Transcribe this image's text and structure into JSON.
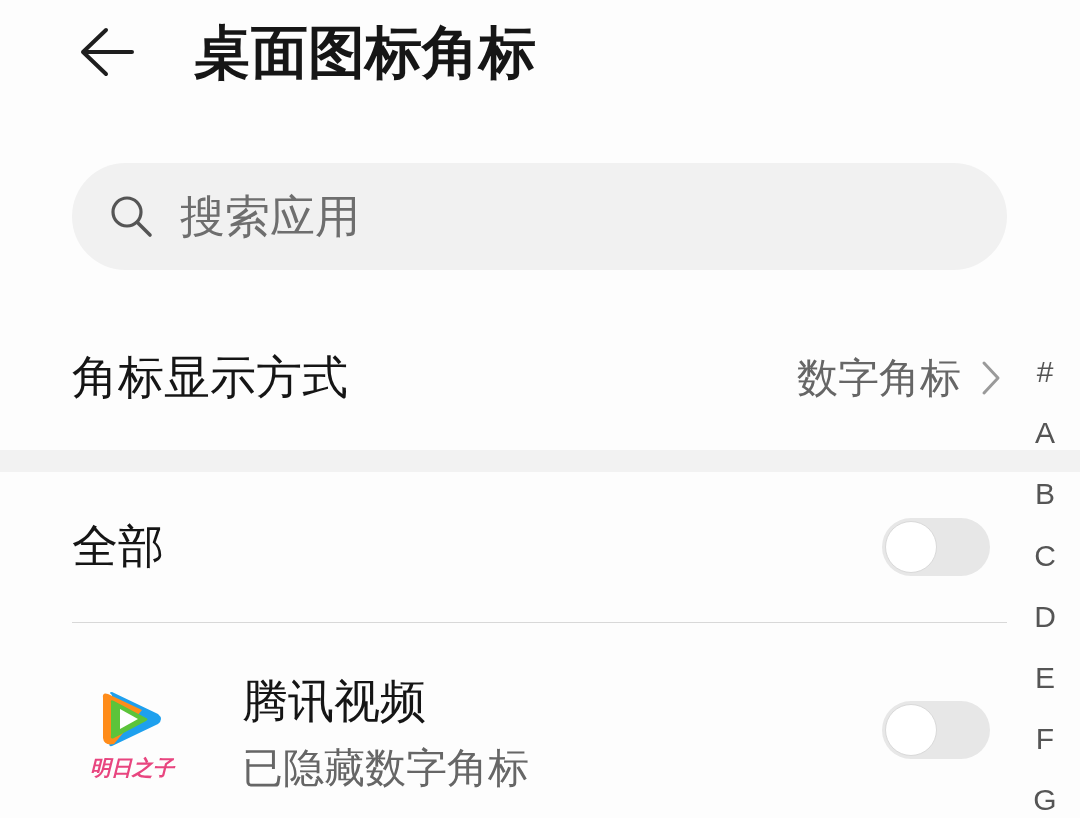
{
  "header": {
    "title": "桌面图标角标"
  },
  "search": {
    "placeholder": "搜索应用"
  },
  "display_mode": {
    "label": "角标显示方式",
    "value": "数字角标"
  },
  "all_toggle": {
    "label": "全部",
    "on": false
  },
  "apps": [
    {
      "name": "腾讯视频",
      "status": "已隐藏数字角标",
      "icon_caption": "明日之子",
      "on": false
    }
  ],
  "index_bar": [
    "#",
    "A",
    "B",
    "C",
    "D",
    "E",
    "F",
    "G"
  ]
}
